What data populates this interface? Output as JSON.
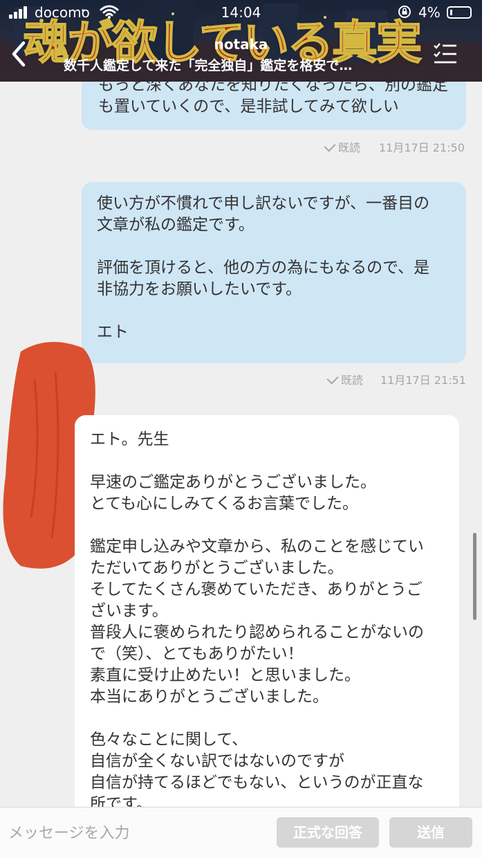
{
  "status_bar": {
    "carrier": "docomo",
    "time": "14:04",
    "battery_percent": "4%",
    "battery_level": 0.04,
    "icons": [
      "signal-icon",
      "wifi-icon",
      "orientation-lock-icon",
      "battery-icon"
    ]
  },
  "header": {
    "banner_text": "魂が欲している真実",
    "chat_name": "notaka",
    "chat_subtitle": "数千人鑑定して来た「完全独自」鑑定を格安で…",
    "icons": [
      "back-chevron-icon",
      "menu-list-icon"
    ]
  },
  "messages": [
    {
      "direction": "outgoing",
      "text": "もっと深くあなたを知りたくなったら、別の鑑定\nも置いていくので、是非試してみて欲しい",
      "read_label": "既読",
      "timestamp": "11月17日 21:50"
    },
    {
      "direction": "outgoing",
      "text": "使い方が不慣れで申し訳ないですが、一番目の\n文章が私の鑑定です。\n\n評価を頂けると、他の方の為にもなるので、是\n非協力をお願いしたいです。\n\nエト",
      "read_label": "既読",
      "timestamp": "11月17日 21:51"
    },
    {
      "direction": "incoming",
      "text": "エト。先生\n\n早速のご鑑定ありがとうございました。\nとても心にしみてくるお言葉でした。\n\n鑑定申し込みや文章から、私のことを感じてい\nただいてありがとうございました。\nそしてたくさん褒めていただき、ありがとうご\nざいます。\n普段人に褒められたり認められることがないの\nで（笑）、とてもありがたい！\n素直に受け止めたい！と思いました。\n本当にありがとうございました。\n\n色々なことに関して、\n自信が全くない訳ではないのですが\n自信が持てるほどでもない、というのが正直な\n所です。"
    }
  ],
  "input_bar": {
    "placeholder": "メッセージを入力",
    "formal_reply_label": "正式な回答",
    "send_label": "送信"
  },
  "colors": {
    "outgoing_bubble": "#cfe6f5",
    "incoming_bubble": "#ffffff",
    "background": "#efeff0",
    "banner_text": "#c8202a",
    "disabled_button": "#d6d6d6"
  }
}
